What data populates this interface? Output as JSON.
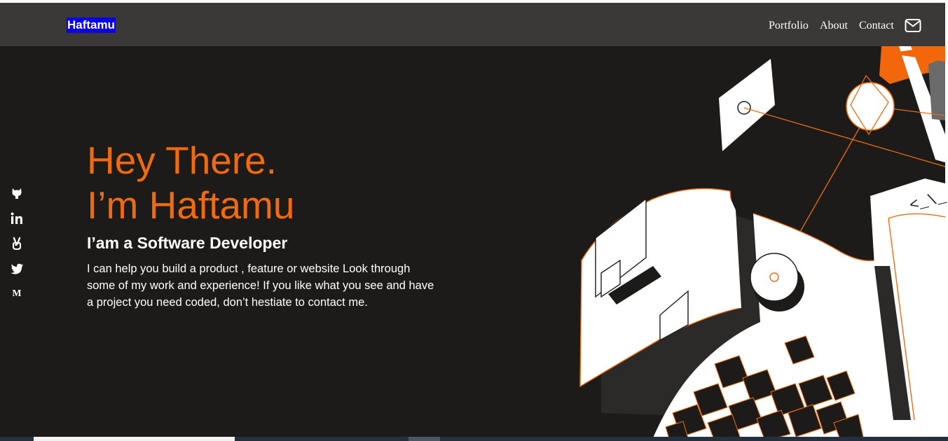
{
  "navbar": {
    "brand": "Haftamu",
    "links": [
      "Portfolio",
      "About",
      "Contact"
    ],
    "mail_icon": "mail-icon"
  },
  "social": {
    "icons": [
      "github-icon",
      "linkedin-icon",
      "peace-hand-icon",
      "twitter-icon",
      "medium-icon"
    ],
    "medium_label": "M"
  },
  "hero": {
    "greeting": "Hey There.",
    "name_line": "I’m Haftamu",
    "role": "I’am a Software Developer",
    "description": "I can help you build a product , feature or website Look through some of my work and experience! If you like what you see and have a project you need coded, don’t hestiate to contact me."
  },
  "illustration": {
    "code_glyph": "<_\\_"
  },
  "colors": {
    "background": "#1c1b1a",
    "navbar": "#3a3938",
    "accent": "#f16a0f",
    "brand_highlight": "#0a00e6",
    "text": "#ffffff"
  }
}
